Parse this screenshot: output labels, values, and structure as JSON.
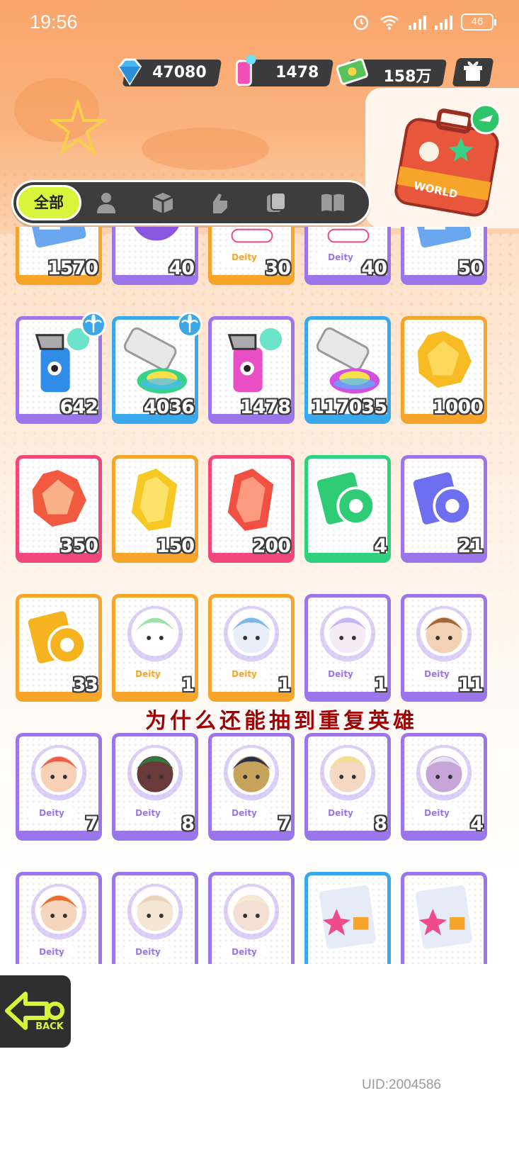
{
  "status_bar": {
    "time": "19:56",
    "battery": "46"
  },
  "currency": [
    {
      "icon": "diamond-icon",
      "value": "47080"
    },
    {
      "icon": "spray-can-icon",
      "value": "1478"
    },
    {
      "icon": "cash-icon",
      "value": "158万"
    }
  ],
  "travel_box": {
    "label": "WORLD"
  },
  "tabs": {
    "all_label": "全部",
    "items": [
      "person-icon",
      "box-icon",
      "hand-icon",
      "cards-icon",
      "book-icon"
    ]
  },
  "inventory": {
    "rows": [
      [
        {
          "count": "1570",
          "color": "orange",
          "type": "ticket"
        },
        {
          "count": "40",
          "color": "purple",
          "type": "disc"
        },
        {
          "count": "30",
          "color": "orange",
          "type": "deity"
        },
        {
          "count": "40",
          "color": "purple",
          "type": "deity"
        },
        {
          "count": "50",
          "color": "purple",
          "type": "ticket"
        }
      ],
      [
        {
          "count": "642",
          "color": "purple",
          "type": "spray-blue",
          "badge": true
        },
        {
          "count": "4036",
          "color": "blue",
          "type": "tube-green",
          "badge": true
        },
        {
          "count": "1478",
          "color": "purple",
          "type": "spray-pink"
        },
        {
          "count": "117035",
          "color": "blue",
          "type": "tube-purple"
        },
        {
          "count": "1000",
          "color": "orange",
          "type": "gold-gem"
        }
      ],
      [
        {
          "count": "350",
          "color": "pink",
          "type": "red-gem"
        },
        {
          "count": "150",
          "color": "orange",
          "type": "yellow-crystal"
        },
        {
          "count": "200",
          "color": "pink",
          "type": "red-crystal"
        },
        {
          "count": "4",
          "color": "green",
          "type": "tape-green"
        },
        {
          "count": "21",
          "color": "purple",
          "type": "tape-purple"
        }
      ],
      [
        {
          "count": "33",
          "color": "orange",
          "type": "tape-gold"
        },
        {
          "count": "1",
          "color": "orange",
          "type": "hero-green"
        },
        {
          "count": "1",
          "color": "orange",
          "type": "hero-blue"
        },
        {
          "count": "1",
          "color": "purple",
          "type": "hero-lilac"
        },
        {
          "count": "11",
          "color": "purple",
          "type": "hero-brown"
        }
      ],
      [
        {
          "count": "7",
          "color": "purple",
          "type": "hero-red"
        },
        {
          "count": "8",
          "color": "purple",
          "type": "hero-hat"
        },
        {
          "count": "7",
          "color": "purple",
          "type": "hero-dark"
        },
        {
          "count": "8",
          "color": "purple",
          "type": "hero-blonde"
        },
        {
          "count": "4",
          "color": "purple",
          "type": "hero-white"
        }
      ],
      [
        {
          "count": "",
          "color": "purple",
          "type": "hero-ginger"
        },
        {
          "count": "",
          "color": "purple",
          "type": "hero-bald"
        },
        {
          "count": "",
          "color": "purple",
          "type": "hero-pale"
        },
        {
          "count": "",
          "color": "blue",
          "type": "sticker"
        },
        {
          "count": "",
          "color": "purple",
          "type": "sticker"
        }
      ]
    ],
    "deity_label": "Deity"
  },
  "caption": "为什么还能抽到重复英雄",
  "back_button": {
    "label": "BACK"
  },
  "uid": "UID:2004586",
  "colors": {
    "orange": "#f7a42b",
    "purple": "#9b75ea",
    "blue": "#3aa8ec",
    "pink": "#f0487a",
    "green": "#2ed27d",
    "accent_tab": "#d9f53b"
  }
}
